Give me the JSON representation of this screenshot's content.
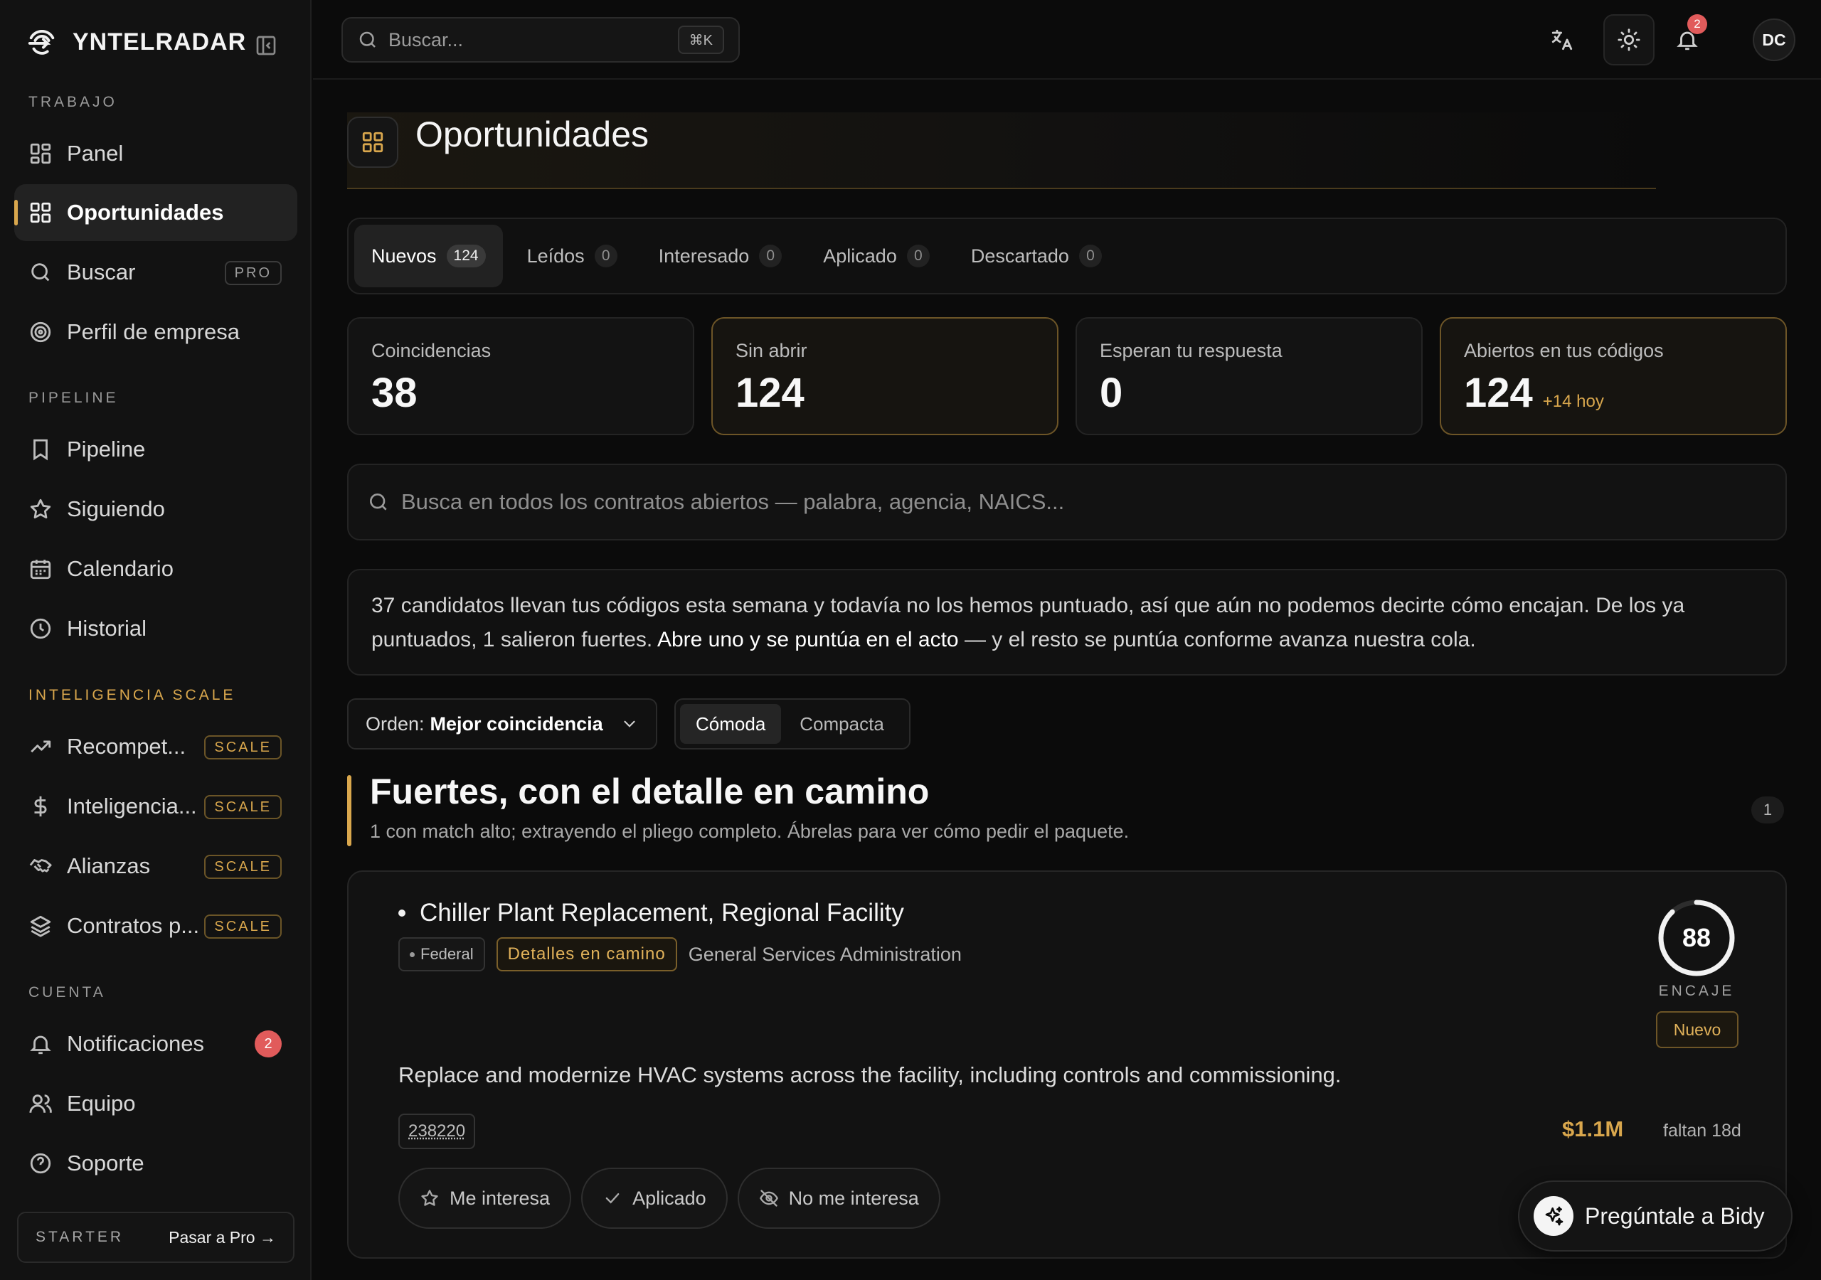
{
  "app": {
    "name": "YNTELRADAR"
  },
  "sidebar": {
    "sections": [
      {
        "label": "TRABAJO"
      },
      {
        "label": "PIPELINE"
      },
      {
        "label": "INTELIGENCIA SCALE"
      },
      {
        "label": "CUENTA"
      }
    ],
    "items": [
      {
        "label": "Panel",
        "icon": "grid-icon"
      },
      {
        "label": "Oportunidades",
        "icon": "grid-icon",
        "active": true
      },
      {
        "label": "Buscar",
        "icon": "search-icon",
        "tag": "PRO"
      },
      {
        "label": "Perfil de empresa",
        "icon": "target-icon"
      },
      {
        "label": "Pipeline",
        "icon": "bookmark-icon"
      },
      {
        "label": "Siguiendo",
        "icon": "star-icon"
      },
      {
        "label": "Calendario",
        "icon": "calendar-icon"
      },
      {
        "label": "Historial",
        "icon": "clock-icon"
      },
      {
        "label": "Recompet...",
        "icon": "trending-up-icon",
        "tag": "SCALE"
      },
      {
        "label": "Inteligencia...",
        "icon": "dollar-icon",
        "tag": "SCALE"
      },
      {
        "label": "Alianzas",
        "icon": "handshake-icon",
        "tag": "SCALE"
      },
      {
        "label": "Contratos p...",
        "icon": "layers-icon",
        "tag": "SCALE"
      },
      {
        "label": "Notificaciones",
        "icon": "bell-icon",
        "badge": "2"
      },
      {
        "label": "Equipo",
        "icon": "users-icon"
      },
      {
        "label": "Soporte",
        "icon": "help-icon"
      }
    ],
    "plan": {
      "name": "STARTER",
      "upgrade_label": "Pasar a Pro →"
    }
  },
  "topbar": {
    "search": {
      "placeholder": "Buscar...",
      "shortcut": "⌘K"
    },
    "notifications_count": "2",
    "avatar_initials": "DC"
  },
  "page": {
    "title": "Oportunidades",
    "tabs": [
      {
        "label": "Nuevos",
        "count": "124",
        "active": true
      },
      {
        "label": "Leídos",
        "count": "0"
      },
      {
        "label": "Interesado",
        "count": "0"
      },
      {
        "label": "Aplicado",
        "count": "0"
      },
      {
        "label": "Descartado",
        "count": "0"
      }
    ],
    "stats": [
      {
        "label": "Coincidencias",
        "value": "38"
      },
      {
        "label": "Sin abrir",
        "value": "124"
      },
      {
        "label": "Esperan tu respuesta",
        "value": "0"
      },
      {
        "label": "Abiertos en tus códigos",
        "value": "124",
        "delta": "+14 hoy"
      }
    ],
    "contract_search": {
      "placeholder": "Busca en todos los contratos abiertos — palabra, agencia, NAICS..."
    },
    "info": {
      "part1": "37 candidatos llevan tus códigos esta semana y todavía no los hemos puntuado, así que aún no podemos decirte cómo encajan. De los ya puntuados, 1 salieron fuertes.",
      "part2": "Abre uno y se puntúa en el acto",
      "part3": "— y el resto se puntúa conforme avanza nuestra cola."
    },
    "sort": {
      "prefix": "Orden:",
      "value": "Mejor coincidencia"
    },
    "density": {
      "options": [
        "Cómoda",
        "Compacta"
      ],
      "active": "Cómoda"
    },
    "group": {
      "title": "Fuertes, con el detalle en camino",
      "subtitle": "1 con match alto; extrayendo el pliego completo. Ábrelas para ver cómo pedir el paquete.",
      "count": "1"
    },
    "opportunity": {
      "title": "Chiller Plant Replacement, Regional Facility",
      "level": "Federal",
      "status_chip": "Detalles en camino",
      "agency": "General Services Administration",
      "score": "88",
      "score_fraction": 0.88,
      "score_label": "ENCAJE",
      "badge": "Nuevo",
      "description": "Replace and modernize HVAC systems across the facility, including controls and commissioning.",
      "naics": "238220",
      "value": "$1.1M",
      "deadline": "faltan 18d",
      "actions": [
        {
          "label": "Me interesa",
          "icon": "star-icon"
        },
        {
          "label": "Aplicado",
          "icon": "check-icon"
        },
        {
          "label": "No me interesa",
          "icon": "eye-off-icon"
        }
      ]
    },
    "assistant": {
      "label": "Pregúntale a Bidy",
      "icon": "sparkles-icon"
    }
  },
  "colors": {
    "accent": "#d9a74d",
    "background": "#0b0b0b",
    "badge_red": "#e15b5b"
  }
}
